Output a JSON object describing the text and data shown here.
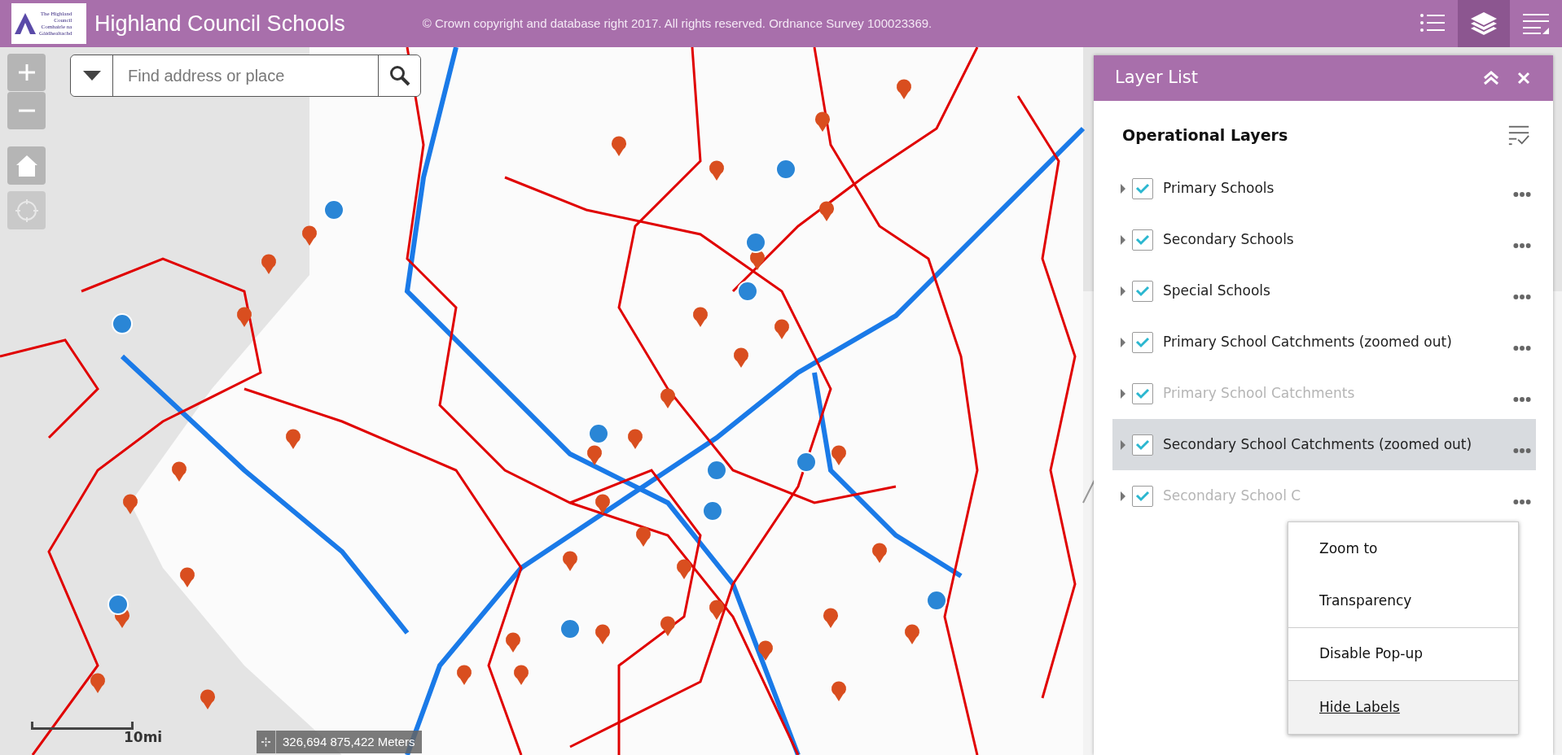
{
  "header": {
    "logo_lines": [
      "The Highland",
      "Council",
      "Comhairle na",
      "Gàidhealtachd"
    ],
    "title": "Highland Council Schools",
    "copyright": "© Crown copyright and database right 2017. All rights reserved. Ordnance Survey 100023369.",
    "tools": [
      {
        "kind": "list",
        "selected": false
      },
      {
        "kind": "layers",
        "selected": true
      },
      {
        "kind": "legend",
        "selected": false
      }
    ]
  },
  "map_controls": [
    {
      "kind": "zoom-in",
      "disabled": false
    },
    {
      "kind": "zoom-out",
      "disabled": false
    },
    {
      "kind": "home",
      "disabled": false
    },
    {
      "kind": "locate",
      "disabled": true
    }
  ],
  "search": {
    "placeholder": "Find address or place"
  },
  "layer_list": {
    "title": "Layer List",
    "section": "Operational Layers",
    "layers": [
      {
        "label": "Primary Schools",
        "checked": true,
        "dimmed": false,
        "selected": false
      },
      {
        "label": "Secondary Schools",
        "checked": true,
        "dimmed": false,
        "selected": false
      },
      {
        "label": "Special Schools",
        "checked": true,
        "dimmed": false,
        "selected": false
      },
      {
        "label": "Primary School Catchments (zoomed out)",
        "checked": true,
        "dimmed": false,
        "selected": false
      },
      {
        "label": "Primary School Catchments",
        "checked": true,
        "dimmed": true,
        "selected": false
      },
      {
        "label": "Secondary School Catchments (zoomed out)",
        "checked": true,
        "dimmed": false,
        "selected": true
      },
      {
        "label": "Secondary School C",
        "checked": true,
        "dimmed": true,
        "selected": false
      }
    ]
  },
  "menu": {
    "items": [
      {
        "label": "Zoom to",
        "selected": false,
        "divider_after": false
      },
      {
        "label": "Transparency",
        "selected": false,
        "divider_after": true
      },
      {
        "label": "Disable Pop-up",
        "selected": false,
        "divider_after": true
      },
      {
        "label": "Hide Labels",
        "selected": true,
        "divider_after": false
      }
    ]
  },
  "scale": {
    "label": "10mi"
  },
  "coordinates": "326,694 875,422 Meters"
}
